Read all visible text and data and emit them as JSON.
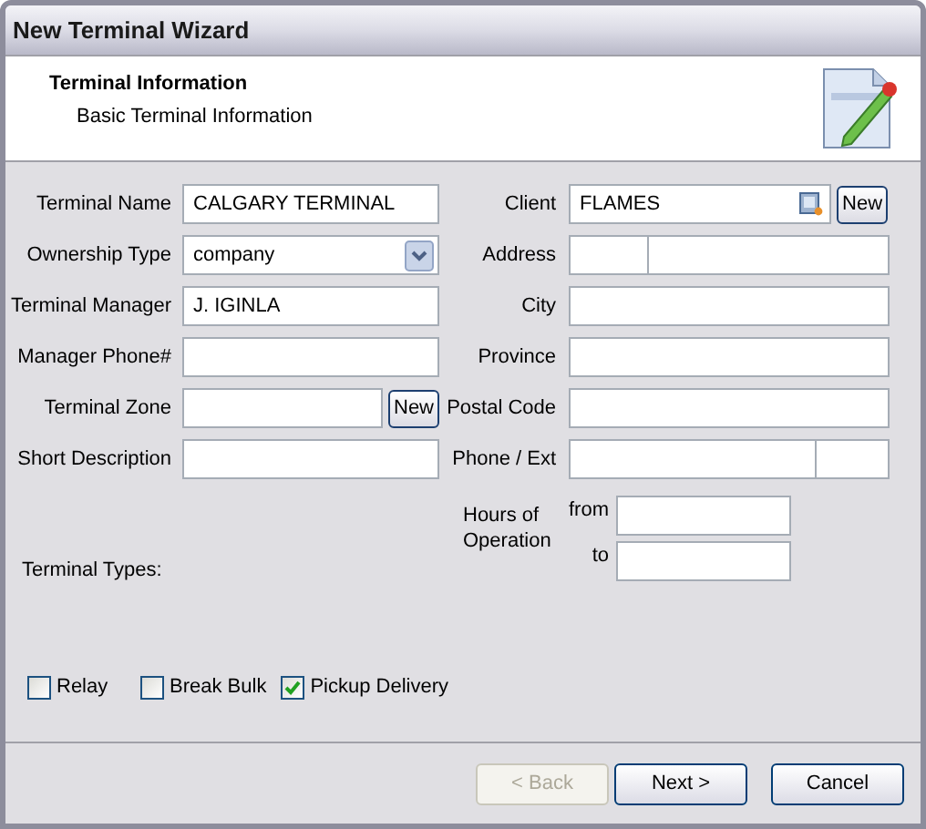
{
  "window": {
    "title": "New Terminal Wizard"
  },
  "header": {
    "title": "Terminal Information",
    "subtitle": "Basic Terminal Information"
  },
  "left_fields": [
    {
      "label": "Terminal Name",
      "kind": "text",
      "value": "CALGARY TERMINAL"
    },
    {
      "label": "Ownership Type",
      "kind": "select",
      "value": "company"
    },
    {
      "label": "Terminal Manager",
      "kind": "text",
      "value": "J. IGINLA"
    },
    {
      "label": "Manager Phone#",
      "kind": "text"
    },
    {
      "label": "Terminal Zone",
      "kind": "text_button",
      "button": "New"
    },
    {
      "label": "Short Description",
      "kind": "text"
    }
  ],
  "right_fields": [
    {
      "label": "Client",
      "kind": "lookup",
      "value": "FLAMES",
      "button": "New"
    },
    {
      "label": "Address",
      "kind": "address"
    },
    {
      "label": "City",
      "kind": "text"
    },
    {
      "label": "Province",
      "kind": "text"
    },
    {
      "label": "Postal Code",
      "kind": "text"
    },
    {
      "label": "Phone / Ext",
      "kind": "phone"
    }
  ],
  "hours": {
    "label": "Hours of Operation",
    "from_label": "from",
    "to_label": "to"
  },
  "terminal_types": {
    "label": "Terminal Types:",
    "options": [
      {
        "label": "Relay",
        "checked": false
      },
      {
        "label": "Break Bulk",
        "checked": false
      },
      {
        "label": "Pickup Delivery",
        "checked": true
      }
    ]
  },
  "buttons": [
    {
      "label": "< Back",
      "disabled": true
    },
    {
      "label": "Next >",
      "disabled": false
    },
    {
      "label": "Cancel",
      "disabled": false
    }
  ]
}
